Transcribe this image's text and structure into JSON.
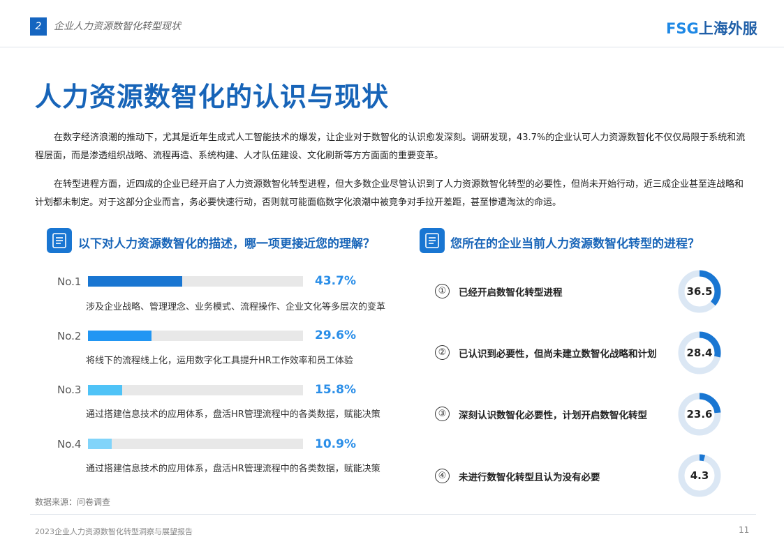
{
  "header": {
    "page_badge": "2",
    "section_title": "企业人力资源数智化转型现状",
    "logo_latin": "FSG",
    "logo_cn": "上海外服"
  },
  "title": "人力资源数智化的认识与现状",
  "paragraphs": [
    "在数字经济浪潮的推动下，尤其是近年生成式人工智能技术的爆发，让企业对于数智化的认识愈发深刻。调研发现，43.7%的企业认可人力资源数智化不仅仅局限于系统和流程层面，而是渗透组织战略、流程再造、系统构建、人才队伍建设、文化刷新等方方面面的重要变革。",
    "在转型进程方面，近四成的企业已经开启了人力资源数智化转型进程，但大多数企业尽管认识到了人力资源数智化转型的必要性，但尚未开始行动，近三成企业甚至连战略和计划都未制定。对于这部分企业而言，务必要快速行动，否则就可能面临数字化浪潮中被竞争对手拉开差距，甚至惨遭淘汰的命运。"
  ],
  "left_section": {
    "icon": "document-list-icon",
    "title": "以下对人力资源数智化的描述，哪一项更接近您的理解？"
  },
  "right_section": {
    "icon": "document-list-icon",
    "title": "您所在的企业当前人力资源数智化转型的进程？"
  },
  "chart_data": [
    {
      "type": "bar",
      "orientation": "horizontal",
      "categories": [
        "No.1",
        "No.2",
        "No.3",
        "No.4"
      ],
      "values": [
        43.7,
        29.6,
        15.8,
        10.9
      ],
      "value_labels": [
        "43.7%",
        "29.6%",
        "15.8%",
        "10.9%"
      ],
      "descriptions": [
        "涉及企业战略、管理理念、业务模式、流程操作、企业文化等多层次的变革",
        "将线下的流程线上化，运用数字化工具提升HR工作效率和员工体验",
        "通过搭建信息技术的应用体系，盘活HR管理流程中的各类数据，赋能决策",
        "通过搭建信息技术的应用体系，盘活HR管理流程中的各类数据，赋能决策"
      ],
      "xlim": [
        0,
        100
      ],
      "colors": [
        "#1976d2",
        "#2196f3",
        "#4fc3f7",
        "#81d4fa"
      ],
      "track_color": "#e8e8e8"
    },
    {
      "type": "pie",
      "style": "donut",
      "markers": [
        "①",
        "②",
        "③",
        "④"
      ],
      "categories": [
        "已经开启数智化转型进程",
        "已认识到必要性，但尚未建立数智化战略和计划",
        "深刻认识数智化必要性，计划开启数智化转型",
        "未进行数智化转型且认为没有必要"
      ],
      "values": [
        36.5,
        28.4,
        23.6,
        4.3
      ],
      "value_labels": [
        "36.5",
        "28.4",
        "23.6",
        "4.3"
      ],
      "fill_color": "#1976d2",
      "track_color": "#dbe7f4"
    }
  ],
  "source_note": "数据来源：问卷调查",
  "footer": {
    "report_title": "2023企业人力资源数智化转型洞察与展望报告",
    "page_number": "11"
  }
}
